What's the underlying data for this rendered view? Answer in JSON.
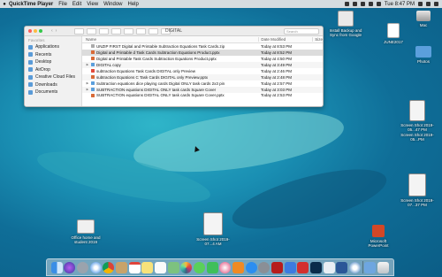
{
  "menubar": {
    "app": "QuickTime Player",
    "items": [
      "File",
      "Edit",
      "View",
      "Window",
      "Help"
    ],
    "clock": "Tue 8:47 PM"
  },
  "finder": {
    "title": "DIGITAL",
    "search_placeholder": "Search",
    "sidebar": {
      "favorites_header": "Favorites",
      "items": [
        "Applications",
        "Recents",
        "Desktop",
        "AirDrop",
        "Creative Cloud Files",
        "Downloads",
        "Documents"
      ]
    },
    "columns": {
      "name": "Name",
      "date": "Date Modified",
      "size": "Size"
    },
    "rows": [
      {
        "name": "UNZIP FIRST Digital and Printable Subtraction Equations Task Cards.zip",
        "date": "Today at 8:53 PM",
        "size": "",
        "type": "zip"
      },
      {
        "name": "Digital and Printable  d Task Cards Subtraction Equations Product.pptx",
        "date": "Today at 8:52 PM",
        "size": "",
        "type": "ppt"
      },
      {
        "name": "Digital and Printable Task Cards Subtraction Equations Product.pptx",
        "date": "Today at 4:50 PM",
        "size": "",
        "type": "ppt"
      },
      {
        "name": "DIGITAL copy",
        "date": "Today at 3:49 PM",
        "size": "",
        "type": "folder"
      },
      {
        "name": "subtraction Equations Task Cards DIGITAL only Preview",
        "date": "Today at 2:46 PM",
        "size": "",
        "type": "pdf"
      },
      {
        "name": "subtraction Equations C Task Cards DIGITAL only Preview.pptx",
        "date": "Today at 2:48 PM",
        "size": "",
        "type": "ppt"
      },
      {
        "name": "Subtraction equations dice playing cards Digital ONLY  task cards 2x3 pin",
        "date": "Today at 2:57 PM",
        "size": "",
        "type": "folder"
      },
      {
        "name": "SUBTRACTION equations DIGITAL  ONLY task cards Square Cover",
        "date": "Today at 3:03 PM",
        "size": "",
        "type": "folder"
      },
      {
        "name": "SUBTRACTION equations DIGITAL ONLY task cards Square Cover.pptx",
        "date": "Today at 2:53 PM",
        "size": "",
        "type": "ppt"
      }
    ]
  },
  "desktop_icons": {
    "install_backup": "Install Backup and Sync from Google",
    "mac": "Mac",
    "june2017": "JUNE2017",
    "photos": "Photos",
    "shot1": "Screen Shot 2019-05...47 PM",
    "shot2": "Screen Shot 2019-05...PM",
    "shot3": "Screen Shot 2019-07...37 PM",
    "office": "Office home and student 2019",
    "center_file": "Screen Shot 2019-07...4 AM",
    "powerpoint": "Microsoft PowerPoint"
  },
  "colors": {
    "wallpaper": "#1a8fb3",
    "accent_folder": "#5b9fdc",
    "close": "#fc605b",
    "minimize": "#fdbc40",
    "zoom": "#34c84a"
  }
}
